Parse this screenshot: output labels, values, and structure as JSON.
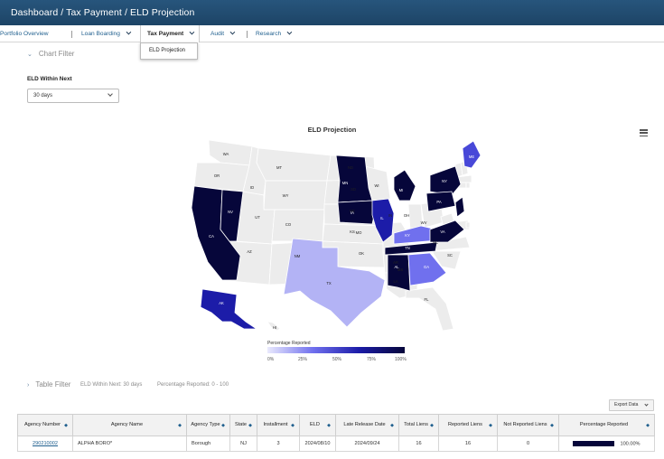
{
  "breadcrumb": "Dashboard / Tax Payment / ELD Projection",
  "nav": {
    "items": [
      "Portfolio Overview",
      "Loan Boarding",
      "Tax Payment",
      "Audit",
      "Research"
    ],
    "dropdown_item": "ELD Projection"
  },
  "chart_filter": {
    "title": "Chart Filter",
    "label": "ELD Within Next",
    "selected": "30 days"
  },
  "chart": {
    "title": "ELD Projection",
    "legend_title": "Percentage Reported",
    "legend_ticks": [
      "0%",
      "25%",
      "50%",
      "75%",
      "100%"
    ]
  },
  "chart_data": {
    "type": "choropleth-map",
    "title": "ELD Projection",
    "color_scale": {
      "min": 0,
      "max": 100,
      "label": "Percentage Reported",
      "low_color": "#e9e9fd",
      "high_color": "#06063a"
    },
    "states": [
      {
        "state": "CA",
        "value": 100
      },
      {
        "state": "NV",
        "value": 100
      },
      {
        "state": "MN",
        "value": 100
      },
      {
        "state": "IA",
        "value": 100
      },
      {
        "state": "MI",
        "value": 100
      },
      {
        "state": "TN",
        "value": 100
      },
      {
        "state": "AL",
        "value": 100
      },
      {
        "state": "NY",
        "value": 100
      },
      {
        "state": "PA",
        "value": 100
      },
      {
        "state": "VA",
        "value": 100
      },
      {
        "state": "NJ",
        "value": 100
      },
      {
        "state": "IL",
        "value": 85
      },
      {
        "state": "AK",
        "value": 85
      },
      {
        "state": "ME",
        "value": 65
      },
      {
        "state": "KY",
        "value": 55
      },
      {
        "state": "GA",
        "value": 45
      },
      {
        "state": "TX",
        "value": 22
      }
    ]
  },
  "table_filter": {
    "title": "Table Filter",
    "within": "ELD Within Next: 30 days",
    "percent": "Percentage Reported: 0 - 100",
    "export_label": "Export Data"
  },
  "table": {
    "headers": [
      "Agency Number",
      "Agency Name",
      "Agency Type",
      "State",
      "Installment",
      "ELD",
      "Late Release Date",
      "Total Liens",
      "Reported Liens",
      "Not Reported Liens",
      "Percentage Reported"
    ],
    "rows": [
      {
        "number": "290210002",
        "name": "ALPHA BORO*",
        "type": "Borough",
        "state": "NJ",
        "installment": "3",
        "eld": "2024/08/10",
        "late": "2024/09/24",
        "total": "16",
        "reported": "16",
        "not_reported": "0",
        "percent": "100.00%",
        "percent_value": 100
      }
    ]
  }
}
